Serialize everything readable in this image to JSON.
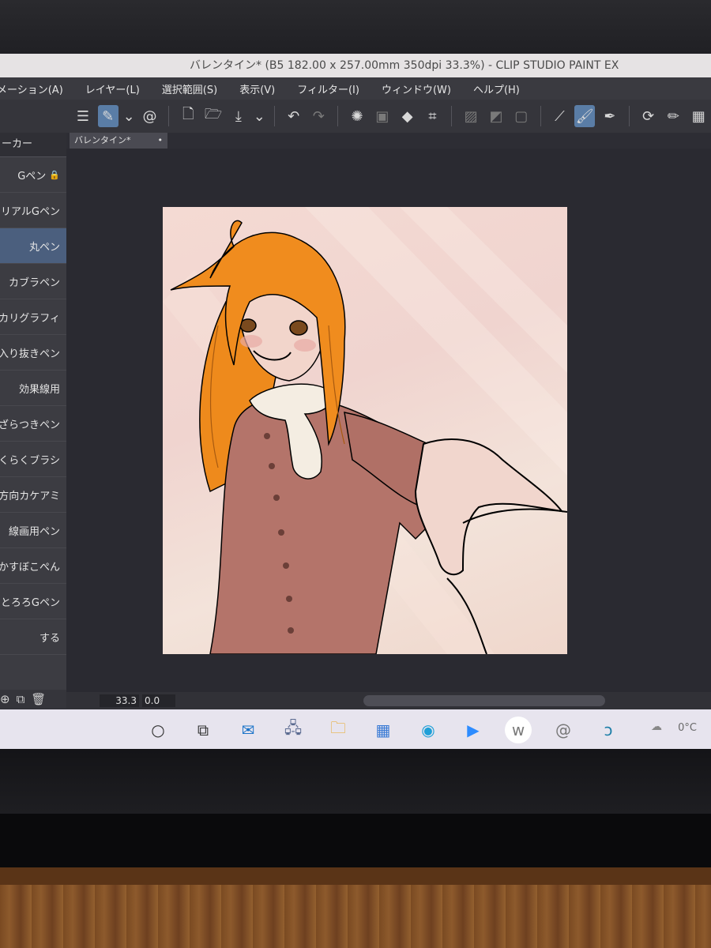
{
  "window": {
    "title": "バレンタイン* (B5 182.00 x 257.00mm 350dpi 33.3%) - CLIP STUDIO PAINT EX"
  },
  "menu": [
    "メーション(A)",
    "レイヤー(L)",
    "選択範囲(S)",
    "表示(V)",
    "フィルター(I)",
    "ウィンドウ(W)",
    "ヘルプ(H)"
  ],
  "toolbar_icons": [
    "menu-icon",
    "brush-tool-icon",
    "chevron-down-icon",
    "spiral-icon",
    "new-file-icon",
    "open-folder-icon",
    "save-icon",
    "chevron-down-icon",
    "undo-icon",
    "redo-icon",
    "loading-icon",
    "select-icon",
    "fill-icon",
    "transform-icon",
    "hatch-icon",
    "gradient-icon",
    "frame-icon",
    "vector-line-icon",
    "brush-stroke-icon",
    "pen-icon",
    "rotate-icon",
    "pencil-icon",
    "checker-icon"
  ],
  "panel": {
    "header": "ーカー",
    "brushes": [
      {
        "label": "Gペン",
        "locked": true,
        "selected": false
      },
      {
        "label": "リアルGペン",
        "locked": false,
        "selected": false
      },
      {
        "label": "丸ペン",
        "locked": false,
        "selected": true
      },
      {
        "label": "カブラペン",
        "locked": false,
        "selected": false
      },
      {
        "label": "カリグラフィ",
        "locked": false,
        "selected": false
      },
      {
        "label": "入り抜きペン",
        "locked": false,
        "selected": false
      },
      {
        "label": "効果線用",
        "locked": false,
        "selected": false
      },
      {
        "label": "ざらつきペン",
        "locked": false,
        "selected": false
      },
      {
        "label": "らくらくブラシ",
        "locked": false,
        "selected": false
      },
      {
        "label": "方向カケアミ",
        "locked": false,
        "selected": false
      },
      {
        "label": "線画用ペン",
        "locked": false,
        "selected": false
      },
      {
        "label": "かすぼこぺん",
        "locked": false,
        "selected": false
      },
      {
        "label": "とろろGペン",
        "locked": false,
        "selected": false
      },
      {
        "label": "する",
        "locked": false,
        "selected": false
      }
    ]
  },
  "document_tab": {
    "label": "バレンタイン*",
    "dot": "•"
  },
  "status": {
    "zoom": "33.3",
    "rotation": "0.0"
  },
  "taskbar": {
    "icons": [
      "search-circle-icon",
      "task-view-icon",
      "mail-icon",
      "network-icon",
      "file-explorer-icon",
      "store-icon",
      "edge-icon",
      "zoom-icon",
      "wacom-icon",
      "clip-studio-icon",
      "clip-studio-paint-icon"
    ],
    "weather": "0°C"
  },
  "colors": {
    "accent": "#5a7da6",
    "selected_brush": "#4b5f7e",
    "canvas_bg": "#f3ddd6",
    "hair": "#f08c1e",
    "coat": "#b06f63"
  }
}
